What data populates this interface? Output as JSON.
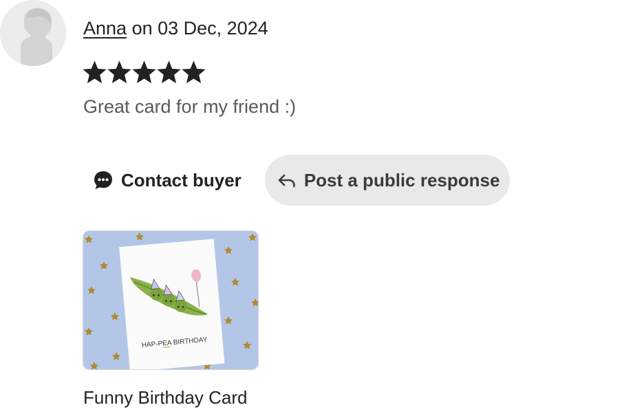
{
  "review": {
    "reviewer_name": "Anna",
    "date_text": "on 03 Dec, 2024",
    "rating": 5,
    "rating_max": 5,
    "text": "Great card for my friend :)"
  },
  "actions": {
    "contact_label": "Contact buyer",
    "contact_icon": "chat-bubble-icon",
    "response_label": "Post a public response",
    "response_icon": "reply-arrow-icon"
  },
  "product": {
    "title": "Funny Birthday Card",
    "card_text": "HAP-PEA BIRTHDAY",
    "background_color": "#b3c6e8"
  },
  "colors": {
    "text_primary": "#222222",
    "text_secondary": "#595959",
    "response_button_bg": "#e9e9e9",
    "star_color": "#222222"
  }
}
